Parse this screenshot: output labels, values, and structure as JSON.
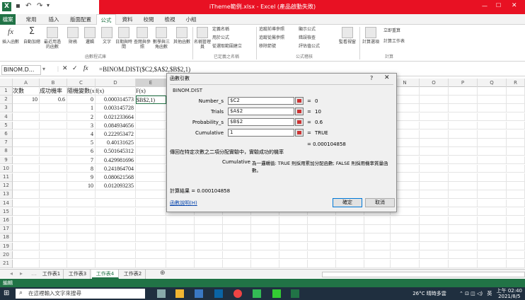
{
  "window": {
    "title": "iTheme範例.xlsx - Excel (產品啟動失敗)",
    "app_icon": "X"
  },
  "ribbon_tabs": [
    "檔案",
    "常用",
    "插入",
    "版面配置",
    "公式",
    "資料",
    "校閱",
    "檢視",
    "小組"
  ],
  "ribbon_active_tab": "公式",
  "ribbon": {
    "buttons": [
      {
        "label": "插入函數",
        "icon": "fx-icon"
      },
      {
        "label": "自動加總",
        "icon": "sigma-icon"
      },
      {
        "label": "最近用過的函數",
        "icon": "star-icon"
      },
      {
        "label": "財務",
        "icon": "book-icon"
      },
      {
        "label": "邏輯",
        "icon": "question-icon"
      },
      {
        "label": "文字",
        "icon": "text-icon"
      },
      {
        "label": "日期與時間",
        "icon": "clock-icon"
      },
      {
        "label": "查閱與參照",
        "icon": "search-icon"
      },
      {
        "label": "數學與三角函數",
        "icon": "theta-icon"
      },
      {
        "label": "其他函數",
        "icon": "more-icon"
      },
      {
        "label": "名稱管理員",
        "icon": "tag-icon"
      },
      {
        "label": "監看視窗",
        "icon": "watch-icon"
      },
      {
        "label": "計算選項",
        "icon": "calc-icon"
      }
    ],
    "small_buttons": [
      "定義名稱",
      "用於公式",
      "從選取範圍建立",
      "追蹤前導參照",
      "追蹤從屬參照",
      "移除箭號",
      "顯示公式",
      "錯誤檢查",
      "評估值公式",
      "立即重算",
      "計算工作表"
    ],
    "groups": [
      "函數程式庫",
      "已定義之名稱",
      "公式稽核",
      "計算"
    ]
  },
  "formula_bar": {
    "name_box": "BINOM.D...",
    "formula": "=BINOM.DIST($C2,$A$2,$B$2,1)"
  },
  "columns": [
    "A",
    "B",
    "C",
    "D",
    "E",
    "F",
    "G",
    "H",
    "I",
    "J",
    "K",
    "L",
    "M",
    "N",
    "O",
    "P",
    "Q",
    "R"
  ],
  "rows": [
    "1",
    "2",
    "3",
    "4",
    "5",
    "6",
    "7",
    "8",
    "9",
    "10",
    "11",
    "12",
    "13",
    "14",
    "15",
    "16",
    "17",
    "18",
    "19",
    "20",
    "21"
  ],
  "cells": {
    "A1": "次數",
    "B1": "成功機率",
    "C1": "隨機變數(x)",
    "D1": "f(x)",
    "E1": "F(x)",
    "A2": "10",
    "B2": "0.6",
    "C2": "0",
    "D2": "0.000314573",
    "E2": "$B$2,1)",
    "C3": "1",
    "D3": "0.003145728",
    "C4": "2",
    "D4": "0.021233664",
    "C5": "3",
    "D5": "0.084934656",
    "C6": "4",
    "D6": "0.222953472",
    "C7": "5",
    "D7": "0.40131625",
    "C8": "6",
    "D8": "0.501645312",
    "C9": "7",
    "D9": "0.429981696",
    "C10": "8",
    "D10": "0.241864704",
    "C11": "9",
    "D11": "0.080621568",
    "C12": "10",
    "D12": "0.012093235"
  },
  "sheet_tabs": [
    "工作表1",
    "工作表3",
    "工作表4",
    "工作表2"
  ],
  "active_sheet": "工作表4",
  "status": "編輯",
  "dialog": {
    "title": "函數引數",
    "help_glyph": "?",
    "close_glyph": "✕",
    "function_name": "BINOM.DIST",
    "args": [
      {
        "label": "Number_s",
        "value": "$C2",
        "result": "0"
      },
      {
        "label": "Trials",
        "value": "$A$2",
        "result": "10"
      },
      {
        "label": "Probability_s",
        "value": "$B$2",
        "result": "0.6"
      },
      {
        "label": "Cumulative",
        "value": "1",
        "result": "TRUE"
      }
    ],
    "eq": "=",
    "overall_result": "= 0.000104858",
    "description": "傳回在特定次數之二項分配實驗中，實驗成功的機率",
    "arg_help_name": "Cumulative",
    "arg_help": "為一邏輯值: TRUE 則採用累加分配函數; FALSE 則採用機率質量函數。",
    "calc_result": "計算結果 = 0.000104858",
    "help_link": "函數說明(H)",
    "ok": "確定",
    "cancel": "取消"
  },
  "taskbar": {
    "search_placeholder": "在這裡輸入文字來搜尋",
    "weather": "26°C 晴時多雲",
    "ime": "英",
    "time": "上午 02:40",
    "date": "2021/8/5"
  },
  "colors": {
    "excel_green": "#217346",
    "title_red": "#e81123",
    "taskbar": "#1f2f3f"
  }
}
